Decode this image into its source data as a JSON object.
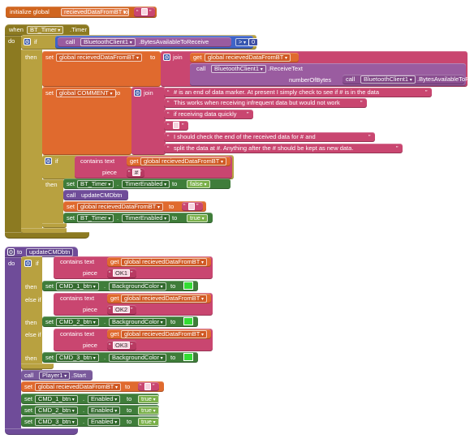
{
  "init": {
    "prefix": "initialize global",
    "varname": "recievedDataFromBT",
    "to": "to",
    "empty_string": " "
  },
  "timer_event": {
    "when": "when",
    "component": "BT_Timer",
    "event": ".Timer",
    "do": "do",
    "if_kw": "if",
    "call_kw": "call",
    "bt_client": "BluetoothClient1",
    "bytes_available": ".BytesAvailableToReceive",
    "compare_op": ">",
    "compare_value": "0",
    "then_kw": "then",
    "set_kw": "set",
    "set_var": "global recievedDataFromBT",
    "to_kw": "to",
    "join_kw": "join",
    "get_kw": "get",
    "get_var": "global recievedDataFromBT",
    "receive_text": ".ReceiveText",
    "number_of_bytes": "numberOfBytes",
    "comment_var": "global COMMENT",
    "comment_lines": [
      "# is an end of data marker. At present I simply check to see if # is in the data",
      "This works when receiving infrequent data but would not work",
      "if receiving data quickly",
      " ",
      "I should check the end of the received data for # and",
      "split the data at #. Anything after the # should be kept as new data."
    ],
    "contains_text": "contains text",
    "piece": "piece",
    "hash_piece": "#",
    "timer_enabled": "TimerEnabled",
    "false_val": "false",
    "true_val": "true",
    "update_proc": "updateCMDbtn"
  },
  "proc": {
    "to_kw": "to",
    "name": "updateCMDbtn",
    "do": "do",
    "if_kw": "if",
    "else_if": "else if",
    "then_kw": "then",
    "contains_text": "contains text",
    "get_kw": "get",
    "get_var": "global recievedDataFromBT",
    "piece": "piece",
    "pieces": [
      "OK1",
      "OK2",
      "OK3"
    ],
    "set_kw": "set",
    "to": "to",
    "buttons": [
      "CMD_1_btn",
      "CMD_2_btn",
      "CMD_3_btn"
    ],
    "bg_prop": "BackgroundColor",
    "bg_color": "#33dd33",
    "call_kw": "call",
    "player": "Player1",
    "start": ".Start",
    "set_var": "global recievedDataFromBT",
    "enabled_prop": "Enabled",
    "true_val": "true"
  }
}
